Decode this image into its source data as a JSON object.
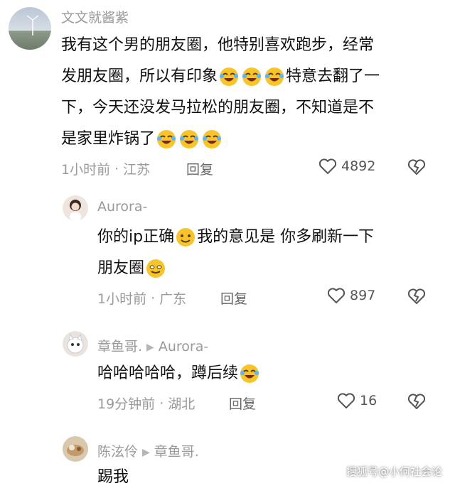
{
  "comments": [
    {
      "author": "文文就酱紫",
      "lines": [
        "我有这个男的朋友圈，他特别喜欢跑步，经常",
        "发朋友圈，所以有印象",
        "特意去翻了一",
        "下，今天还没发马拉松的朋友圈，不知道是不",
        "是家里炸锅了"
      ],
      "time": "1小时前",
      "location": "江苏",
      "reply_label": "回复",
      "likes": "4892"
    },
    {
      "author": "Aurora-",
      "text_part1": "你的ip正确",
      "text_part2": "我的意见是 你多刷新一下",
      "text_line2": "朋友圈",
      "time": "1小时前",
      "location": "广东",
      "reply_label": "回复",
      "likes": "897"
    },
    {
      "author": "章鱼哥.",
      "reply_to": "Aurora-",
      "text": "哈哈哈哈哈，蹲后续",
      "time": "19分钟前",
      "location": "湖北",
      "reply_label": "回复",
      "likes": "16"
    },
    {
      "author": "陈泫伶",
      "reply_to": "章鱼哥.",
      "text": "踢我"
    }
  ],
  "watermark": "搜狐号@小何社会论",
  "colors": {
    "meta": "#9a9a9a",
    "text": "#111111",
    "emoji": "#f7c52b"
  }
}
